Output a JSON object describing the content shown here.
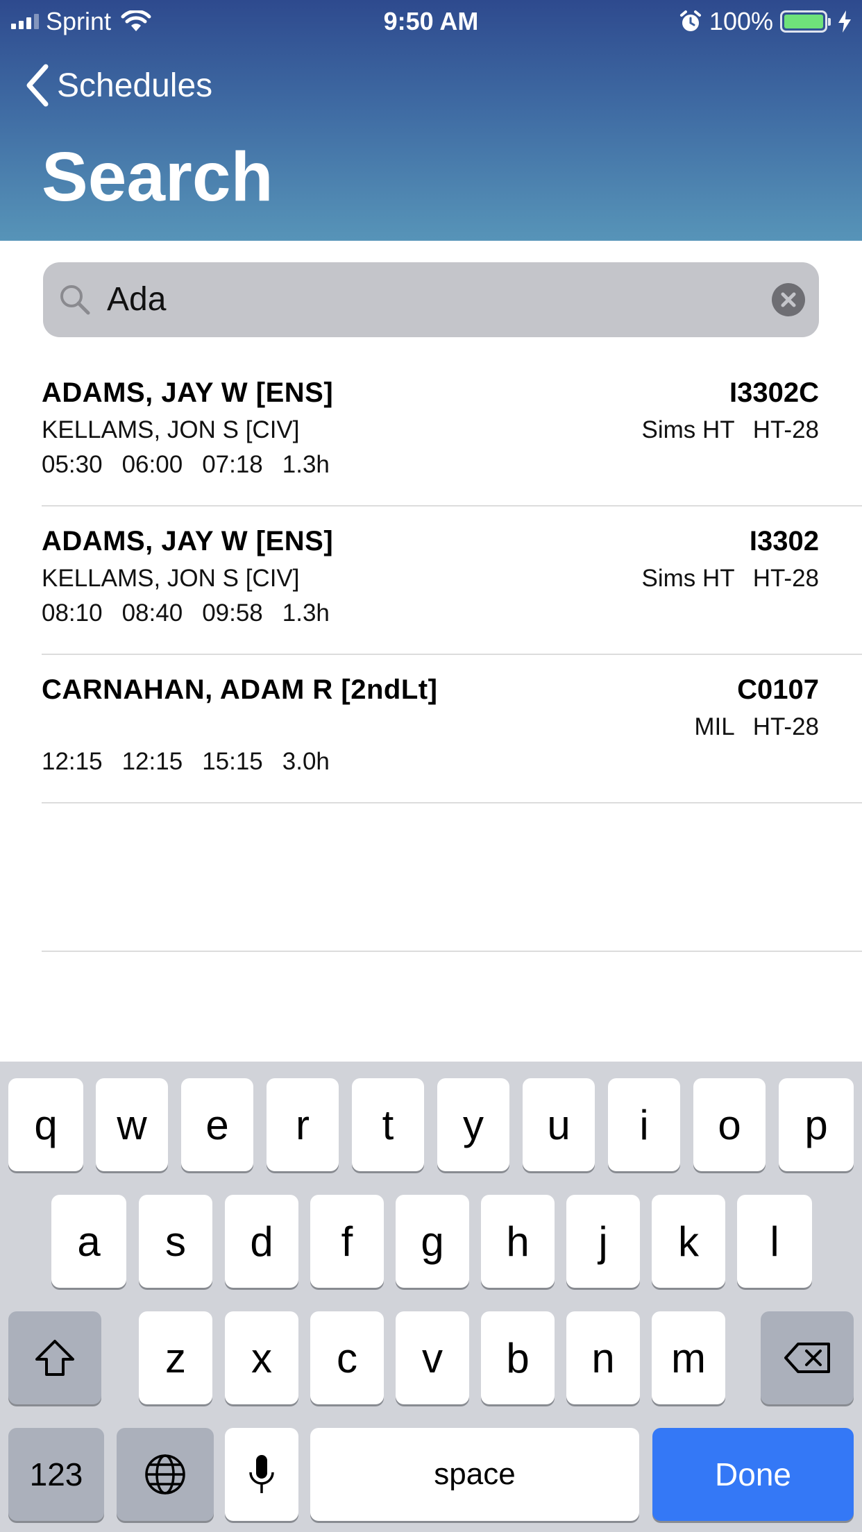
{
  "status_bar": {
    "carrier": "Sprint",
    "time": "9:50 AM",
    "battery": "100%",
    "battery_color": "#6fe27a"
  },
  "nav": {
    "back_label": "Schedules",
    "title": "Search"
  },
  "search": {
    "value": "Ada"
  },
  "results": [
    {
      "name": "ADAMS, JAY W [ENS]",
      "sub": "KELLAMS, JON S [CIV]",
      "times": [
        "05:30",
        "06:00",
        "07:18",
        "1.3h"
      ],
      "code": "I3302C",
      "location": "Sims HT",
      "unit": "HT-28"
    },
    {
      "name": "ADAMS, JAY W [ENS]",
      "sub": "KELLAMS, JON S [CIV]",
      "times": [
        "08:10",
        "08:40",
        "09:58",
        "1.3h"
      ],
      "code": "I3302",
      "location": "Sims HT",
      "unit": "HT-28"
    },
    {
      "name": "CARNAHAN, ADAM R [2ndLt]",
      "sub": "",
      "times": [
        "12:15",
        "12:15",
        "15:15",
        "3.0h"
      ],
      "code": "C0107",
      "location": "MIL",
      "unit": "HT-28"
    }
  ],
  "keyboard": {
    "row1": [
      "q",
      "w",
      "e",
      "r",
      "t",
      "y",
      "u",
      "i",
      "o",
      "p"
    ],
    "row2": [
      "a",
      "s",
      "d",
      "f",
      "g",
      "h",
      "j",
      "k",
      "l"
    ],
    "row3": [
      "z",
      "x",
      "c",
      "v",
      "b",
      "n",
      "m"
    ],
    "numbers_label": "123",
    "space_label": "space",
    "done_label": "Done",
    "accent": "#3478f6"
  }
}
